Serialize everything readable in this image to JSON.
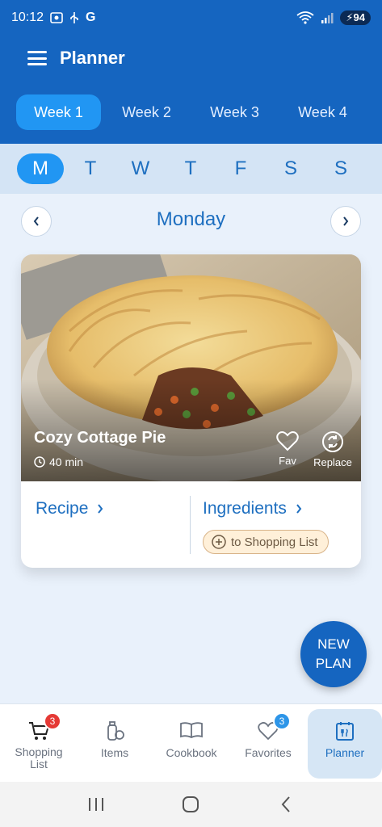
{
  "status_bar": {
    "time": "10:12",
    "left_icons": [
      "screenshot-icon",
      "usb-icon",
      "google-icon"
    ],
    "google_letter": "G",
    "battery": "94",
    "wifi_label": "4G"
  },
  "app_bar": {
    "title": "Planner"
  },
  "weeks": [
    "Week 1",
    "Week 2",
    "Week 3",
    "Week 4"
  ],
  "active_week": 0,
  "days": [
    "M",
    "T",
    "W",
    "T",
    "F",
    "S",
    "S"
  ],
  "active_day": 0,
  "day_title": "Monday",
  "meal": {
    "name": "Cozy Cottage Pie",
    "time": "40 min",
    "fav_label": "Fav",
    "replace_label": "Replace",
    "recipe_label": "Recipe",
    "ingredients_label": "Ingredients",
    "shopping_chip": "to Shopping List"
  },
  "fab": {
    "line1": "NEW",
    "line2": "PLAN"
  },
  "bottom_nav": [
    {
      "label": "Shopping\nList",
      "icon": "cart-icon",
      "badge": "3"
    },
    {
      "label": "Items",
      "icon": "items-icon",
      "badge": ""
    },
    {
      "label": "Cookbook",
      "icon": "book-icon",
      "badge": ""
    },
    {
      "label": "Favorites",
      "icon": "heart-icon",
      "badge": "3"
    },
    {
      "label": "Planner",
      "icon": "planner-icon",
      "badge": ""
    }
  ],
  "colors": {
    "primary": "#1565c0",
    "accent": "#2196f3",
    "link": "#1e6fc0",
    "badge_red": "#e53935",
    "badge_blue": "#2d95e8"
  }
}
